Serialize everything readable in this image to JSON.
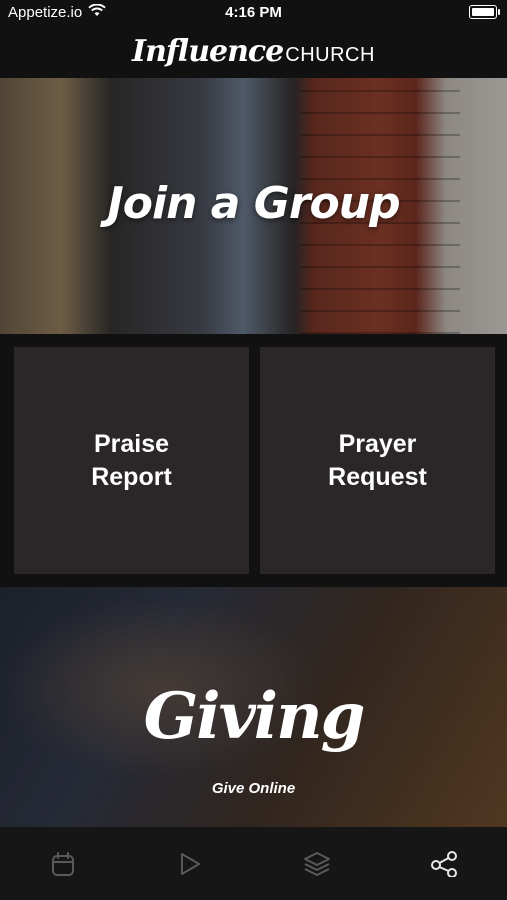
{
  "status_bar": {
    "carrier": "Appetize.io",
    "time": "4:16 PM"
  },
  "header": {
    "logo_script": "Influence",
    "logo_church": "CHURCH"
  },
  "tiles": {
    "join": {
      "title": "Join a Group"
    },
    "praise": {
      "line1": "Praise",
      "line2": "Report"
    },
    "prayer": {
      "line1": "Prayer",
      "line2": "Request"
    },
    "giving": {
      "title": "Giving",
      "subtitle": "Give Online"
    }
  },
  "tab_bar": {
    "tabs": [
      {
        "icon": "calendar-icon",
        "active": false
      },
      {
        "icon": "play-icon",
        "active": false
      },
      {
        "icon": "layers-icon",
        "active": false
      },
      {
        "icon": "share-icon",
        "active": true
      }
    ],
    "inactive_color": "#5a5a5a",
    "active_color": "#e8e8e8"
  }
}
